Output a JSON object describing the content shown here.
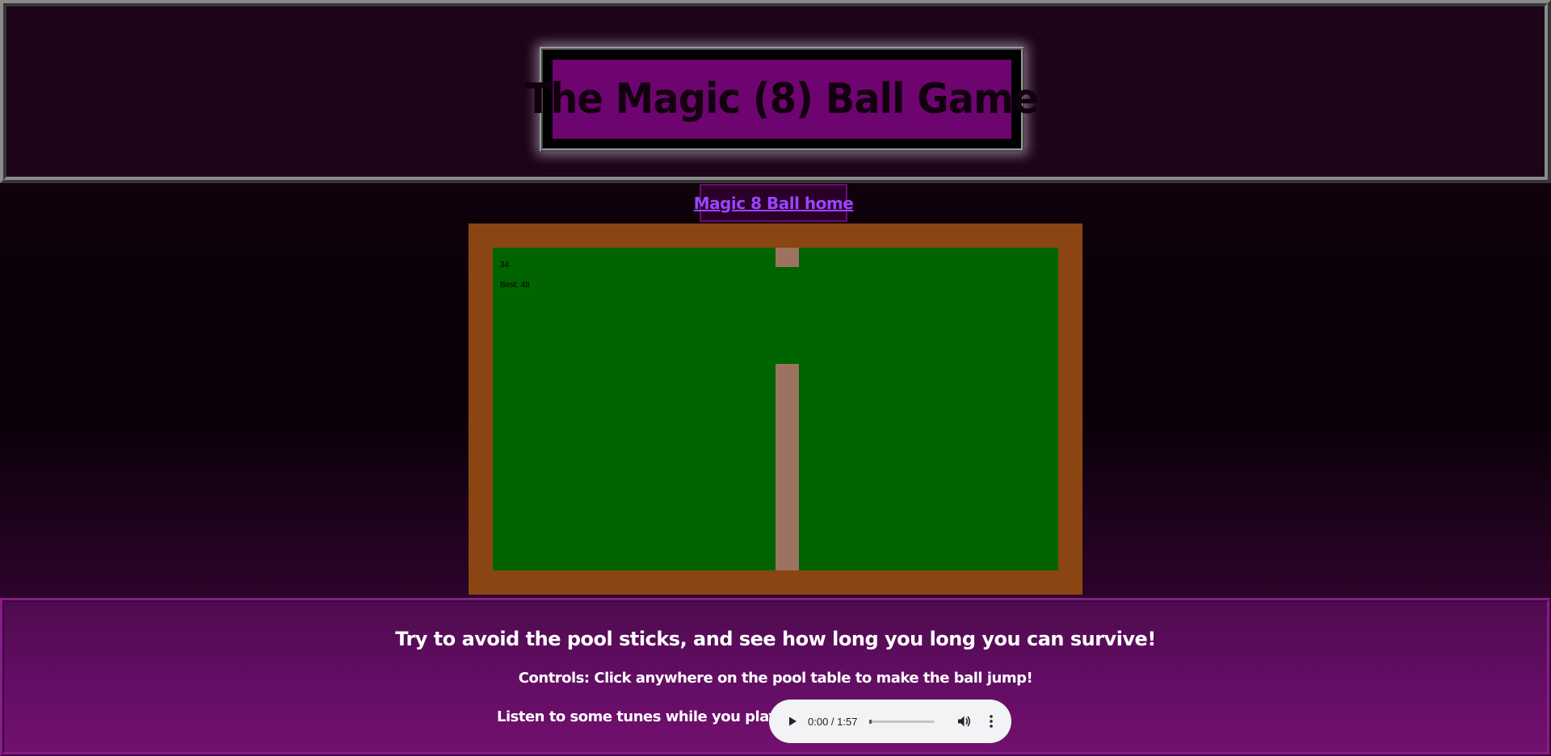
{
  "header": {
    "title": "The Magic (8) Ball Game"
  },
  "nav": {
    "home_link": "Magic 8 Ball home"
  },
  "game": {
    "score": "34",
    "best": "Best: 48"
  },
  "footer": {
    "instructions": "Try to avoid the pool sticks, and see how long you long you can survive!",
    "controls": "Controls: Click anywhere on the pool table to make the ball jump!",
    "tunes_label": "Listen to some tunes while you play!"
  },
  "audio": {
    "time": "0:00 / 1:57",
    "progress": 0
  },
  "colors": {
    "table_frame": "#8b4513",
    "felt": "#006400",
    "stick": "#9c7360",
    "title_bg": "#6e0470",
    "link": "#9b44ff"
  },
  "icons": {
    "play": "play-icon",
    "volume": "volume-icon",
    "more": "more-vert-icon"
  }
}
